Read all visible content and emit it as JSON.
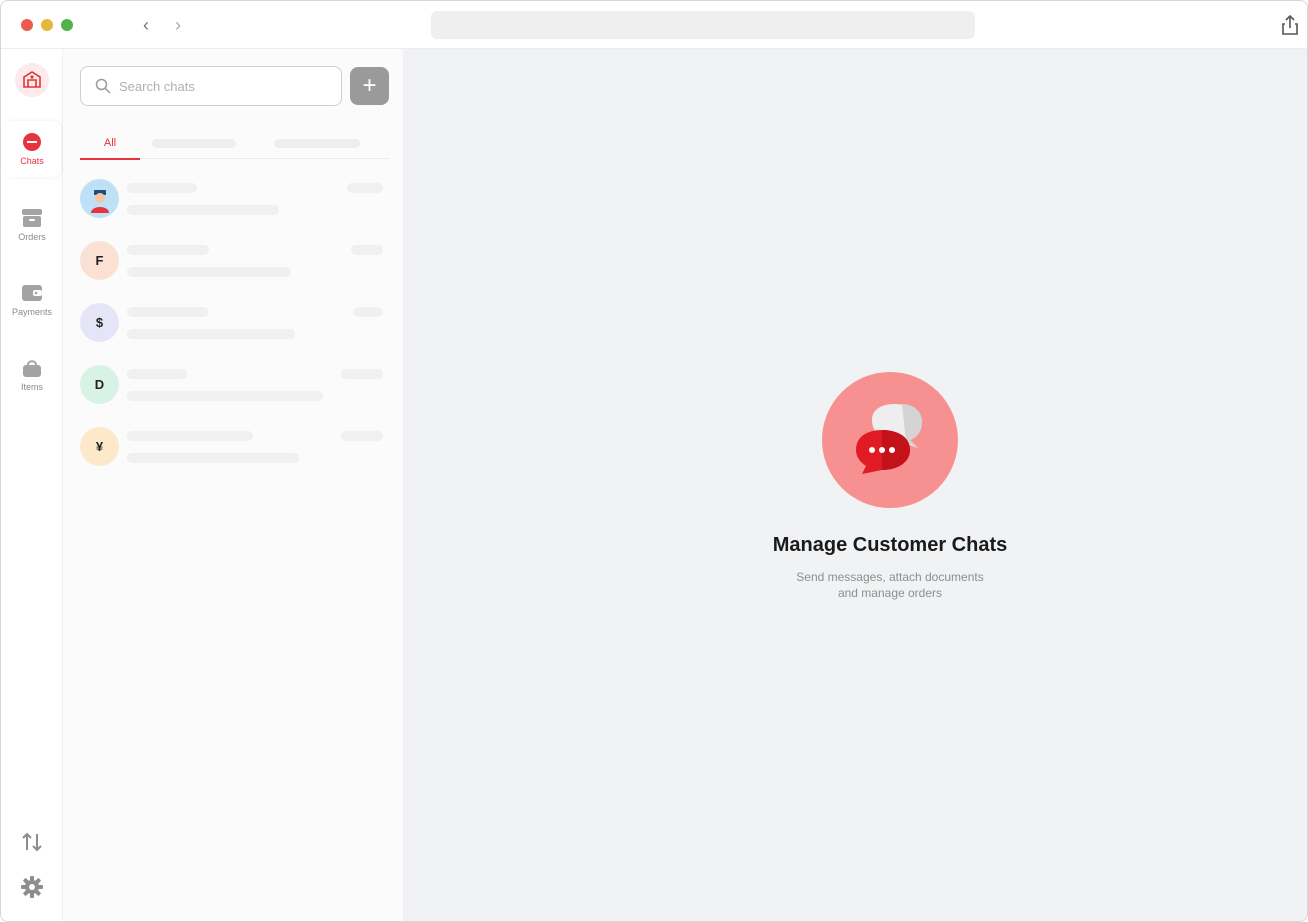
{
  "window": {
    "nav_back": "‹",
    "nav_forward": "›"
  },
  "rail": {
    "items": [
      {
        "label": "Chats",
        "icon": "chat-bubble-icon",
        "active": true
      },
      {
        "label": "Orders",
        "icon": "archive-box-icon",
        "active": false
      },
      {
        "label": "Payments",
        "icon": "wallet-icon",
        "active": false
      },
      {
        "label": "Items",
        "icon": "shopping-bag-icon",
        "active": false
      }
    ],
    "bottom": [
      "sort-arrows-icon",
      "gear-icon"
    ]
  },
  "panel": {
    "search_placeholder": "Search chats",
    "add_label": "+",
    "tabs": [
      {
        "label": "All",
        "active": true
      }
    ],
    "chats": [
      {
        "initial": "",
        "avatar_color": "#bfe1f7",
        "type": "image"
      },
      {
        "initial": "F",
        "avatar_color": "#fbe1d3"
      },
      {
        "initial": "$",
        "avatar_color": "#e6e5f8"
      },
      {
        "initial": "D",
        "avatar_color": "#d8f2e6"
      },
      {
        "initial": "¥",
        "avatar_color": "#fbe9c9"
      }
    ]
  },
  "main": {
    "title": "Manage Customer Chats",
    "subtitle_line1": "Send messages, attach documents",
    "subtitle_line2": "and manage orders"
  },
  "colors": {
    "accent": "#e8323c",
    "hero_circle": "#f79191"
  }
}
